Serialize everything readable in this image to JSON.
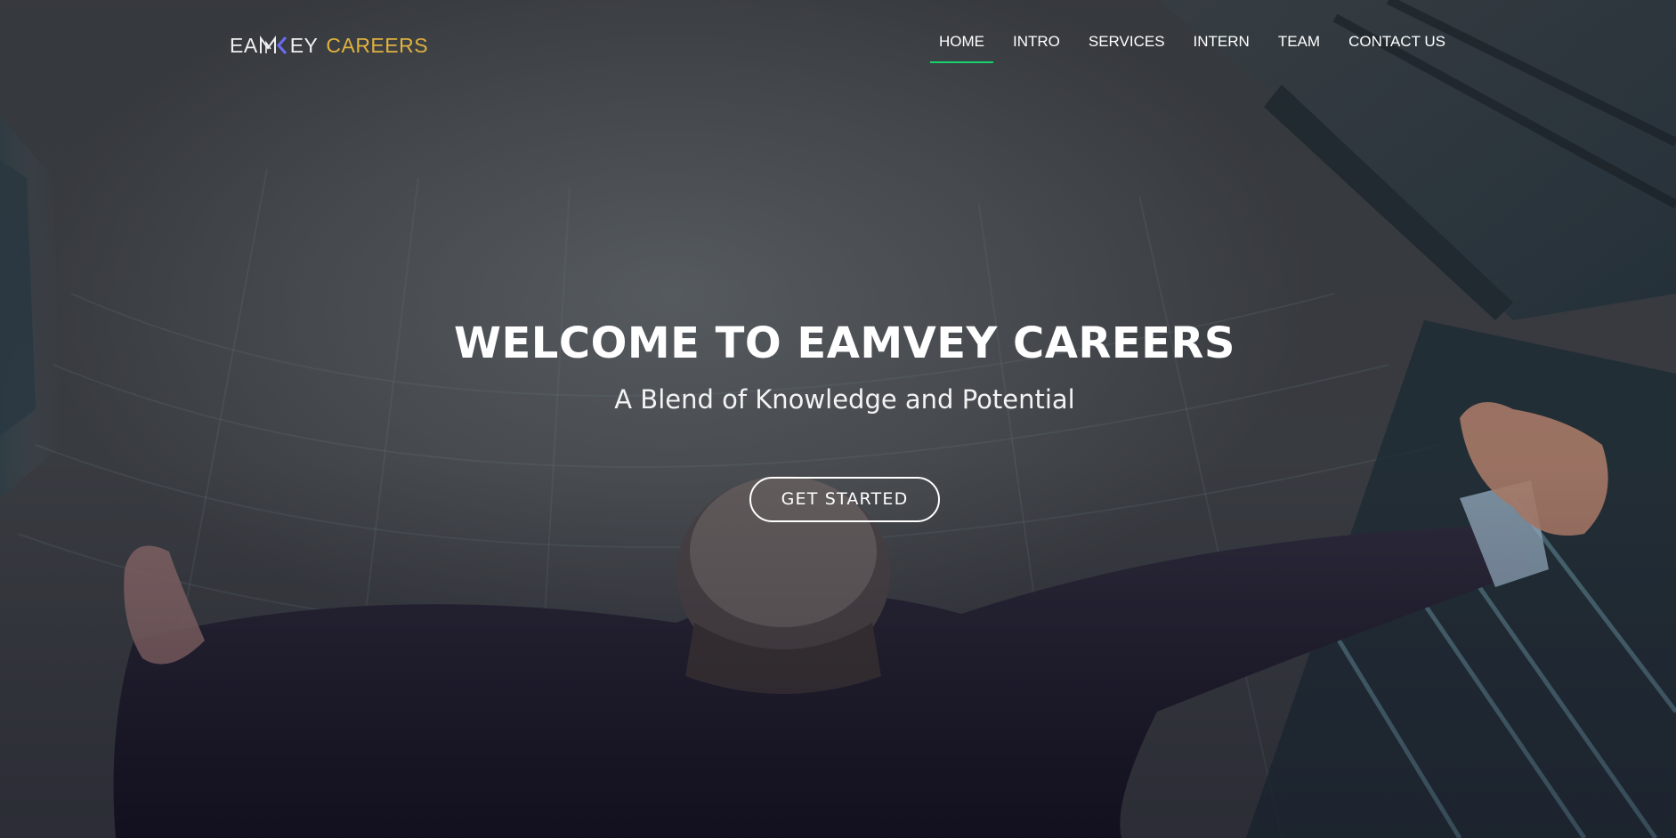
{
  "brand": {
    "name_part1": "EA",
    "name_part2": "EY",
    "name_part3": "CAREERS",
    "mark_icon": "mv-chevron-logo-mark",
    "gold_color": "#e0b23e",
    "mark_color": "#6a6cf0"
  },
  "nav": {
    "items": [
      {
        "label": "HOME",
        "active": true
      },
      {
        "label": "INTRO",
        "active": false
      },
      {
        "label": "SERVICES",
        "active": false
      },
      {
        "label": "INTERN",
        "active": false
      },
      {
        "label": "TEAM",
        "active": false
      },
      {
        "label": "CONTACT US",
        "active": false
      }
    ],
    "active_indicator_color": "#18d26e"
  },
  "hero": {
    "title": "WELCOME TO EAMVEY CAREERS",
    "subtitle": "A Blend of Knowledge and Potential",
    "cta_label": "GET STARTED",
    "background_image": "businessman-arms-raised-low-angle-office-building"
  }
}
